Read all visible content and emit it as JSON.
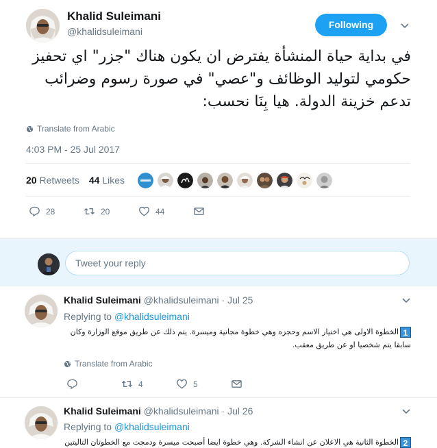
{
  "main_tweet": {
    "author_name": "Khalid Suleimani",
    "author_handle": "@khalidsuleimani",
    "follow_label": "Following",
    "text": "في بداية حياة المنشأة يفترض ان يكون هناك \"جزر\" اي تحفيز حكومي لتوليد الوظائف و\"عصي\" في صورة رسوم وضرائب تدعم خزينة الدولة. هيا بِنَا نحسب:",
    "translate_label": "Translate from Arabic",
    "timestamp": "4:03 PM - 25 Jul 2017",
    "retweets_count": "20",
    "retweets_label": "Retweets",
    "likes_count": "44",
    "likes_label": "Likes",
    "reply_count": "28",
    "retweet_count": "20",
    "like_count": "44"
  },
  "reply_box": {
    "placeholder": "Tweet your reply"
  },
  "replies": [
    {
      "author_name": "Khalid Suleimani",
      "author_handle": "@khalidsuleimani",
      "date": "· Jul 25",
      "replying_prefix": "Replying to",
      "replying_to": "@khalidsuleimani",
      "number": "1",
      "text": "الخطوة الاولى هي اختيار الاسم وحجزه وهي خطوة مجانية وميسرة. يتم ذلك عن طريق موقع الوزارة وكان سابقا يتم شخصيا او عن طريق معقب.",
      "translate_label": "Translate from Arabic",
      "retweet_count": "4",
      "like_count": "5"
    },
    {
      "author_name": "Khalid Suleimani",
      "author_handle": "@khalidsuleimani",
      "date": "· Jul 26",
      "replying_prefix": "Replying to",
      "replying_to": "@khalidsuleimani",
      "number": "2",
      "text": "الخطوة الثانية هي الاعلان عن انشاء الشركة. وهي خطوة ايضا أصبحت ميسرة ودمجت مع الخطوتان التاليتين"
    }
  ],
  "colors": {
    "accent": "#1da1f2",
    "link": "#1b95e0",
    "muted": "#657786",
    "reply_box_bg": "#e8f5fd"
  },
  "icons": [
    "chevron-down-icon",
    "globe-icon",
    "reply-icon",
    "retweet-icon",
    "heart-icon",
    "envelope-icon"
  ]
}
